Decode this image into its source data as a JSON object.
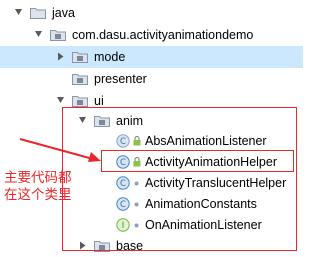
{
  "tree": {
    "rows": [
      {
        "label": "java",
        "icon": "source-folder-icon",
        "expanded": true
      },
      {
        "label": "com.dasu.activityanimationdemo",
        "icon": "package-folder-icon",
        "expanded": true
      },
      {
        "label": "mode",
        "icon": "package-folder-icon",
        "expanded": false,
        "selected": true
      },
      {
        "label": "presenter",
        "icon": "package-folder-icon",
        "expanded": false
      },
      {
        "label": "ui",
        "icon": "package-folder-icon",
        "expanded": true
      },
      {
        "label": "anim",
        "icon": "package-folder-icon",
        "expanded": true
      },
      {
        "label": "AbsAnimationListener",
        "icon": "abstract-class-icon"
      },
      {
        "label": "ActivityAnimationHelper",
        "icon": "class-icon"
      },
      {
        "label": "ActivityTranslucentHelper",
        "icon": "class-icon"
      },
      {
        "label": "AnimationConstants",
        "icon": "class-icon"
      },
      {
        "label": "OnAnimationListener",
        "icon": "interface-icon"
      },
      {
        "label": "base",
        "icon": "package-folder-icon",
        "expanded": false
      }
    ]
  },
  "annotation": {
    "text": "主要代码都在这个类里"
  },
  "colors": {
    "selected_row": "#cce8ff",
    "annotation_red": "#e8282b",
    "class_icon": "#3c87c7",
    "interface_icon": "#6abb3f",
    "folder": "#a4aab3"
  }
}
